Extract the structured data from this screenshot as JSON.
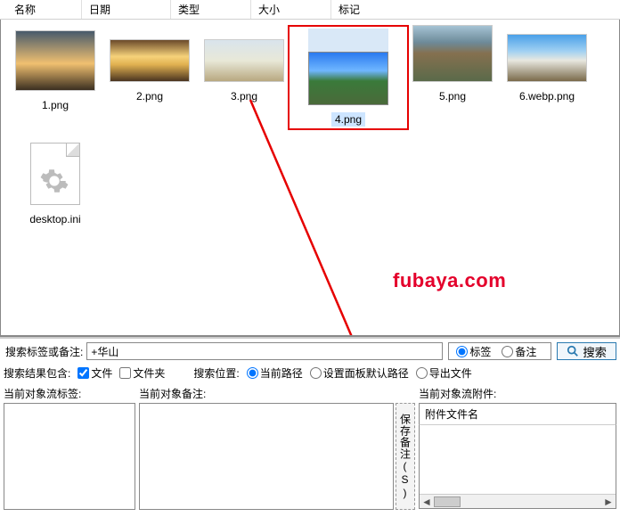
{
  "header": {
    "name": "名称",
    "date": "日期",
    "type": "类型",
    "size": "大小",
    "tag": "标记"
  },
  "files": [
    {
      "name": "1.png"
    },
    {
      "name": "2.png"
    },
    {
      "name": "3.png"
    },
    {
      "name": "4.png",
      "selected": true
    },
    {
      "name": "5.png"
    },
    {
      "name": "6.webp.png"
    },
    {
      "name": "desktop.ini"
    }
  ],
  "watermark": "fubaya.com",
  "search": {
    "label": "搜索标签或备注:",
    "value": "+华山",
    "radio_tag": "标签",
    "radio_note": "备注",
    "button": "搜索"
  },
  "filters": {
    "result_label": "搜索结果包含:",
    "file": "文件",
    "folder": "文件夹",
    "location_label": "搜索位置:",
    "current_path": "当前路径",
    "default_path": "设置面板默认路径",
    "export": "导出文件"
  },
  "panels": {
    "tags_title": "当前对象流标签:",
    "notes_title": "当前对象备注:",
    "save_note": "保存备注(S)",
    "attach_title": "当前对象流附件:",
    "attach_col": "附件文件名"
  }
}
